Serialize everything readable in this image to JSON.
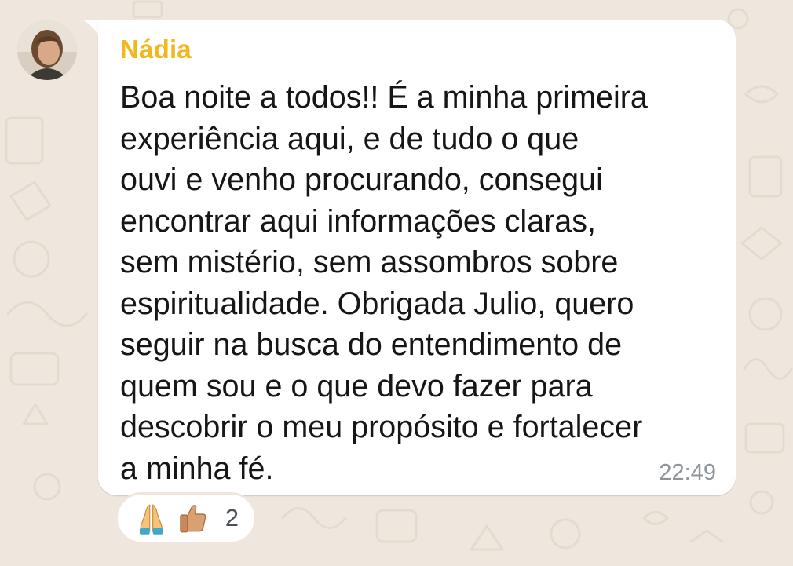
{
  "chat": {
    "avatar_icon": "user-avatar-photo",
    "sender_name": "Nádia",
    "sender_color": "#f0b71e",
    "message_lines": [
      "Boa noite a todos!! É a minha primeira",
      "experiência aqui, e de tudo o que",
      "ouvi e venho procurando, consegui",
      "encontrar aqui informações claras,",
      "sem mistério, sem assombros sobre",
      "espiritualidade. Obrigada Julio, quero",
      "seguir na busca do entendimento de",
      "quem sou e o que devo fazer para",
      "descobrir o meu propósito e fortalecer",
      "a minha fé."
    ],
    "time": "22:49",
    "reactions": {
      "emojis": [
        "folded-hands-icon",
        "thumbs-up-icon"
      ],
      "count": "2"
    }
  },
  "colors": {
    "wallpaper": "#efe7de",
    "bubble": "#ffffff",
    "text": "#161616",
    "time": "#8d959a"
  }
}
